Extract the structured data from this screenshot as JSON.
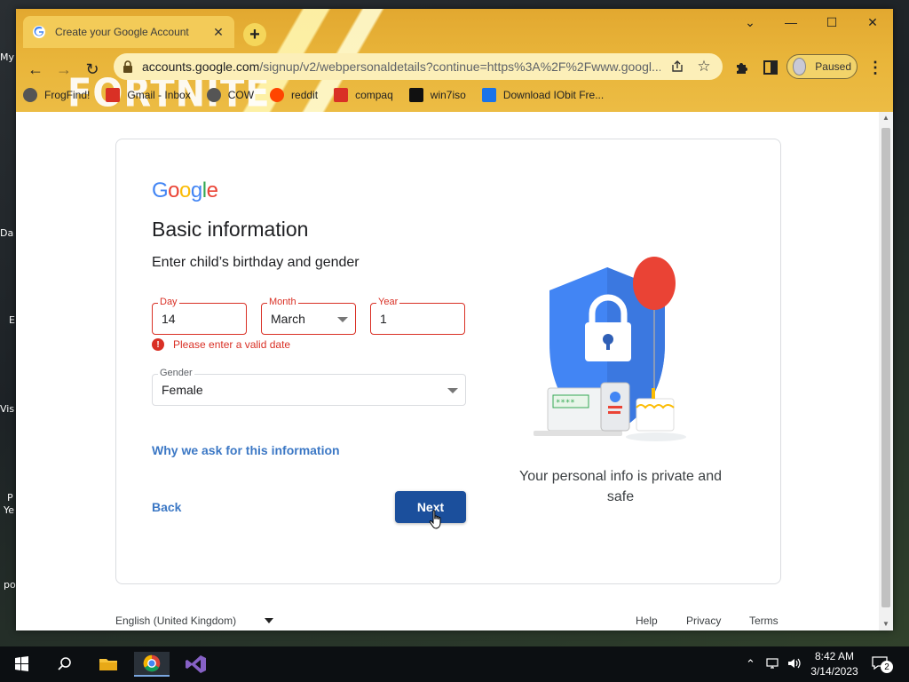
{
  "desktop": {
    "icon_labels": [
      "My",
      "Da",
      "E",
      "Vis",
      "P",
      "Ye",
      "po"
    ]
  },
  "browser": {
    "tab": {
      "title": "Create your Google Account",
      "close_glyph": "✕"
    },
    "new_tab_glyph": "+",
    "window_controls": {
      "tab_search": "⌄",
      "minimize": "—",
      "maximize": "☐",
      "close": "✕"
    },
    "nav": {
      "back": "←",
      "forward": "→",
      "reload": "↻"
    },
    "omnibox": {
      "host": "accounts.google.com",
      "path": "/signup/v2/webpersonaldetails?continue=https%3A%2F%2Fwww.googl...",
      "share_icon": "share-icon",
      "star_glyph": "☆"
    },
    "profile": {
      "label": "Paused"
    },
    "menu_glyph": "⋮",
    "theme_logo": "FORTNITE",
    "bookmarks": [
      {
        "label": "FrogFind!",
        "icon": "globe-icon",
        "color": "#555555"
      },
      {
        "label": "Gmail - Inbox",
        "icon": "gmail-icon",
        "color": "#d93025"
      },
      {
        "label": "COW",
        "icon": "globe-icon",
        "color": "#555555"
      },
      {
        "label": "reddit",
        "icon": "reddit-icon",
        "color": "#ff4500"
      },
      {
        "label": "compaq",
        "icon": "compaq-icon",
        "color": "#d93025"
      },
      {
        "label": "win7iso",
        "icon": "tw-icon",
        "color": "#111111"
      },
      {
        "label": "Download IObit Fre...",
        "icon": "iobit-icon",
        "color": "#1a73e8"
      }
    ]
  },
  "page": {
    "logo": "Google",
    "title": "Basic information",
    "subtitle": "Enter child’s birthday and gender",
    "day": {
      "label": "Day",
      "value": "14"
    },
    "month": {
      "label": "Month",
      "value": "March"
    },
    "year": {
      "label": "Year",
      "value": "1"
    },
    "error": "Please enter a valid date",
    "gender": {
      "label": "Gender",
      "value": "Female"
    },
    "why_link": "Why we ask for this information",
    "back_button": "Back",
    "next_button": "Next",
    "privacy_text": "Your personal info is private and safe",
    "illustration_code": "****",
    "footer": {
      "language": "English (United Kingdom)",
      "help": "Help",
      "privacy": "Privacy",
      "terms": "Terms"
    }
  },
  "taskbar": {
    "time": "8:42 AM",
    "date": "3/14/2023",
    "notification_count": "2"
  },
  "colors": {
    "accent_blue": "#1b4f9c",
    "link_blue": "#3c78c5",
    "error_red": "#d93025",
    "chrome_theme": "#e9b53a"
  }
}
